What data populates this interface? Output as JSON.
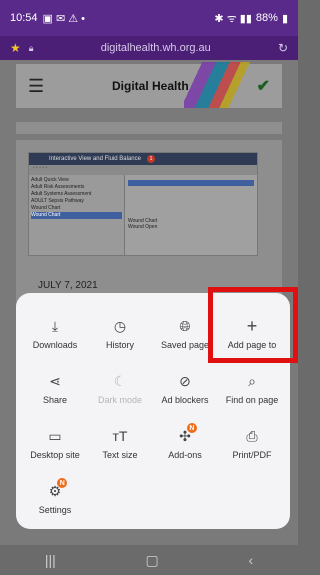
{
  "status_bar": {
    "time": "10:54",
    "battery": "88%"
  },
  "url_bar": {
    "url": "digitalhealth.wh.org.au"
  },
  "site": {
    "title": "Digital Health"
  },
  "article_image": {
    "window_title": "Interactive View and Fluid Balance",
    "list_items": [
      "Adult Quick View",
      "Adult Risk Assessments",
      "Adult Systems Assessment",
      "ADULT Sepsis Pathway",
      "Wound Chart",
      "Wound Chart"
    ],
    "right_labels": [
      "Wound Chart",
      "Wound Open"
    ]
  },
  "post_date": "JULY 7, 2021",
  "menu": {
    "items": [
      {
        "label": "Downloads",
        "icon": "download-icon",
        "enabled": true
      },
      {
        "label": "History",
        "icon": "clock-icon",
        "enabled": true
      },
      {
        "label": "Saved page",
        "icon": "globe-download-icon",
        "enabled": true
      },
      {
        "label": "Add page to",
        "icon": "plus-icon",
        "enabled": true
      },
      {
        "label": "Share",
        "icon": "share-icon",
        "enabled": true
      },
      {
        "label": "Dark mode",
        "icon": "moon-icon",
        "enabled": false
      },
      {
        "label": "Ad blockers",
        "icon": "block-icon",
        "enabled": true
      },
      {
        "label": "Find on page",
        "icon": "find-page-icon",
        "enabled": true
      },
      {
        "label": "Desktop site",
        "icon": "monitor-icon",
        "enabled": true
      },
      {
        "label": "Text size",
        "icon": "text-size-icon",
        "enabled": true
      },
      {
        "label": "Add-ons",
        "icon": "puzzle-icon",
        "enabled": true,
        "badge": "N"
      },
      {
        "label": "Print/PDF",
        "icon": "printer-icon",
        "enabled": true
      },
      {
        "label": "Settings",
        "icon": "gear-icon",
        "enabled": true,
        "badge": "N"
      }
    ]
  },
  "colors": {
    "status_bar": "#5a2a8a",
    "highlight": "#e01010",
    "badge": "#ef6c1a"
  }
}
